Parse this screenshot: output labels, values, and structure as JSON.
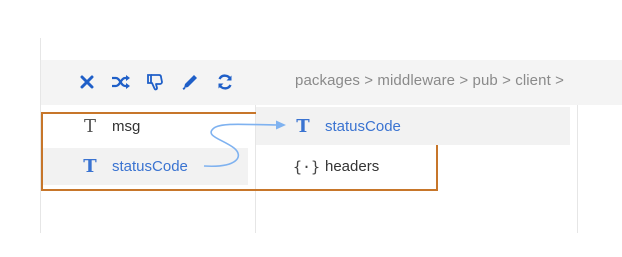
{
  "toolbar": {
    "icons": [
      "close-icon",
      "shuffle-icon",
      "thumbs-down-icon",
      "pencil-icon",
      "refresh-icon"
    ],
    "accent_color": "#1f5fc8"
  },
  "breadcrumb": "packages > middleware > pub > client >",
  "source_column": {
    "items": [
      {
        "type_icon": "T",
        "label": "msg"
      },
      {
        "type_icon": "T",
        "label": "statusCode",
        "selected": true
      }
    ]
  },
  "target_column": {
    "items": [
      {
        "type_icon": "T",
        "label": "statusCode",
        "selected": true
      },
      {
        "type_icon": "{·}",
        "label": "headers"
      }
    ]
  },
  "colors": {
    "highlight_border": "#c7762a",
    "link_blue": "#3a73d1",
    "arrow": "#7fb2f0"
  }
}
